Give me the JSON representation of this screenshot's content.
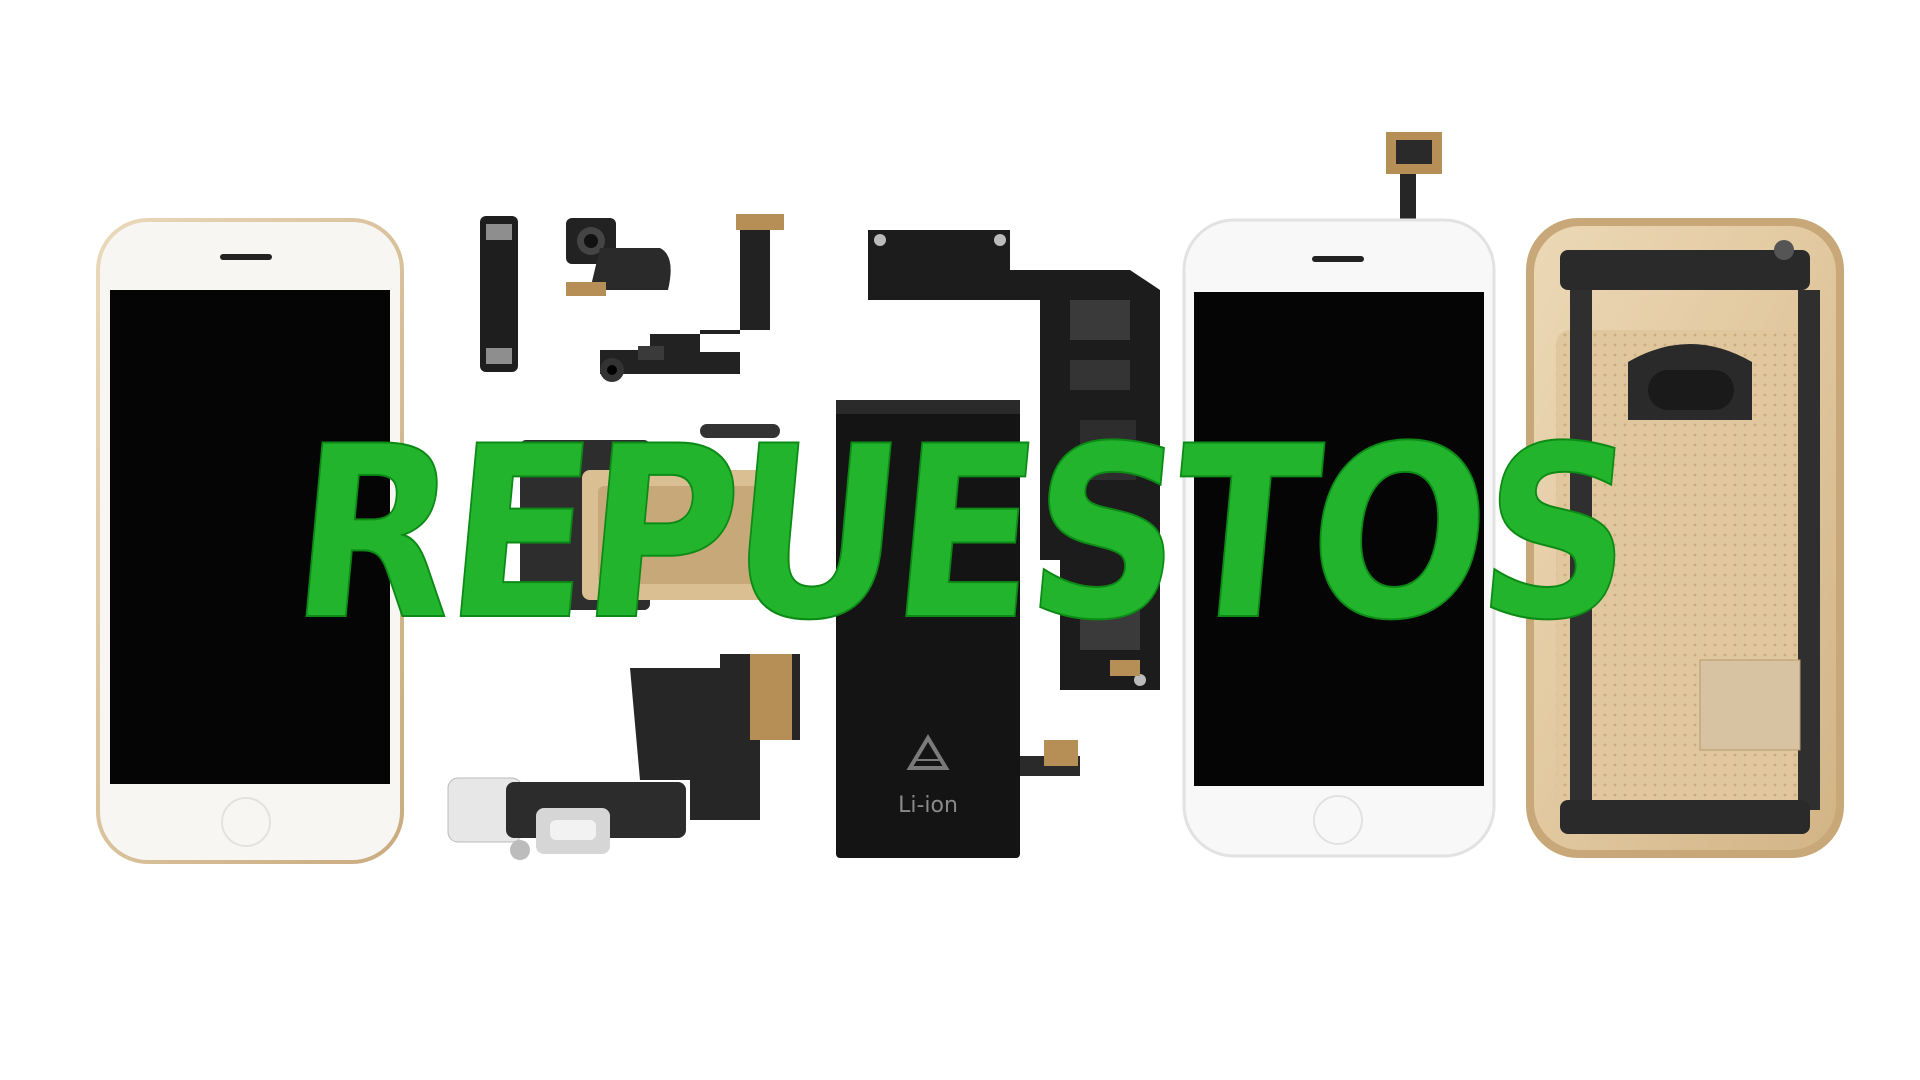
{
  "title": "REPUESTOS",
  "battery_label": "Li-ion",
  "colors": {
    "title_green": "#22b42c",
    "background": "#ffffff",
    "phone_white": "#f6f6f4",
    "phone_gold_rim": "#d9c3a0",
    "screen_black": "#050505",
    "pcb_black": "#1c1c1c",
    "gold_back": "#e3cba4"
  },
  "icons": [
    "recycle-icon"
  ]
}
